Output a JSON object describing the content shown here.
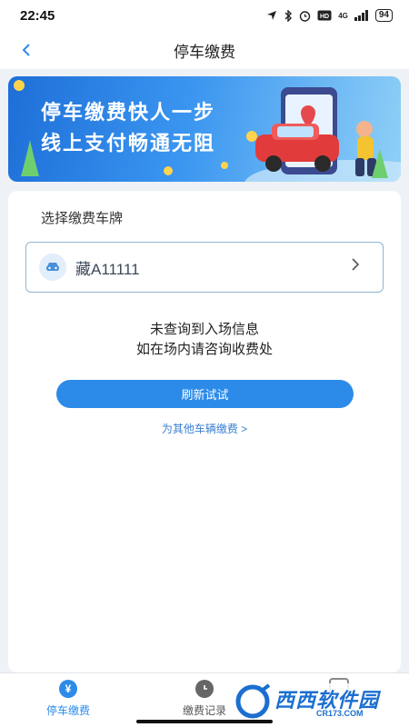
{
  "status_bar": {
    "time": "22:45",
    "signal_label": "4G",
    "battery": "94"
  },
  "nav": {
    "title": "停车缴费",
    "back_icon": "back-chevron-icon"
  },
  "banner": {
    "line1": "停车缴费快人一步",
    "line2": "线上支付畅通无阻"
  },
  "plate_section": {
    "label": "选择缴费车牌",
    "plate": "藏A11111"
  },
  "info": {
    "line1": "未查询到入场信息",
    "line2": "如在场内请咨询收费处"
  },
  "actions": {
    "refresh_label": "刷新试试",
    "other_vehicle_link": "为其他车辆缴费 >"
  },
  "tab_bar": {
    "items": [
      {
        "label": "停车缴费",
        "icon": "yen-icon",
        "active": true
      },
      {
        "label": "缴费记录",
        "icon": "clock-icon",
        "active": false
      }
    ]
  },
  "watermark": {
    "name": "西西软件园",
    "domain": "CR173.COM"
  },
  "colors": {
    "accent": "#2c8be8",
    "background": "#eef1f5",
    "link": "#3a7fd0"
  }
}
